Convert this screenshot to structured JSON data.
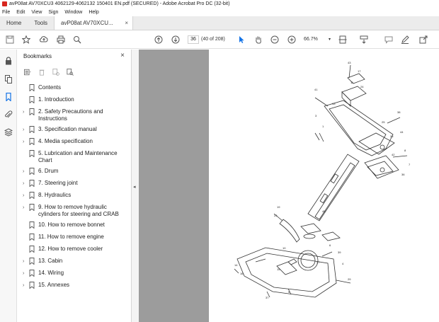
{
  "window": {
    "title": "avP08at AV70XCU3 4062129-4062132 150401 EN.pdf (SECURED) - Adobe Acrobat Pro DC (32-bit)"
  },
  "menu": [
    "File",
    "Edit",
    "View",
    "Sign",
    "Window",
    "Help"
  ],
  "tabs": {
    "home": "Home",
    "tools": "Tools",
    "document": "avP08at AV70XCU...",
    "close": "×"
  },
  "toolbar": {
    "page_current": "36",
    "page_info": "(40 of 208)",
    "zoom": "66.7%",
    "icons": [
      "save-icon",
      "bookmark-star-icon",
      "upload-icon",
      "print-icon",
      "search-icon",
      "page-up-icon",
      "page-down-icon",
      "cursor-icon",
      "hand-icon",
      "zoom-out-icon",
      "zoom-in-icon",
      "page-fit-icon",
      "scroll-mode-icon",
      "comment-icon",
      "sign-icon",
      "share-icon"
    ]
  },
  "bookmarks": {
    "title": "Bookmarks",
    "close": "×",
    "items": [
      {
        "label": "Contents",
        "expandable": false
      },
      {
        "label": "1. Introduction",
        "expandable": false
      },
      {
        "label": "2. Safety Precautions and Instructions",
        "expandable": true
      },
      {
        "label": "3. Specification manual",
        "expandable": true
      },
      {
        "label": "4. Media specification",
        "expandable": true
      },
      {
        "label": "5. Lubrication and Maintenance Chart",
        "expandable": false
      },
      {
        "label": "6. Drum",
        "expandable": true
      },
      {
        "label": "7. Steering joint",
        "expandable": true
      },
      {
        "label": "8. Hydraulics",
        "expandable": true
      },
      {
        "label": "9. How to remove hydraulic cylinders for steering and CRAB",
        "expandable": true
      },
      {
        "label": "10. How to remove bonnet",
        "expandable": false
      },
      {
        "label": "11. How to remove engine",
        "expandable": false
      },
      {
        "label": "12. How to remove cooler",
        "expandable": false
      },
      {
        "label": "13. Cabin",
        "expandable": true
      },
      {
        "label": "14. Wiring",
        "expandable": true
      },
      {
        "label": "15. Annexes",
        "expandable": true
      }
    ]
  },
  "drawing_labels": [
    "41",
    "43",
    "17",
    "11",
    "24",
    "13",
    "3",
    "25",
    "38",
    "44",
    "26",
    "42",
    "8",
    "7",
    "36",
    "1",
    "19",
    "23",
    "10",
    "15",
    "14",
    "16",
    "37",
    "9",
    "6",
    "39",
    "29",
    "4",
    "45",
    "27"
  ],
  "colors": {
    "accent_red": "#d7261e",
    "viewer_bg": "#9c9c9c",
    "cursor_blue": "#1473e6"
  }
}
